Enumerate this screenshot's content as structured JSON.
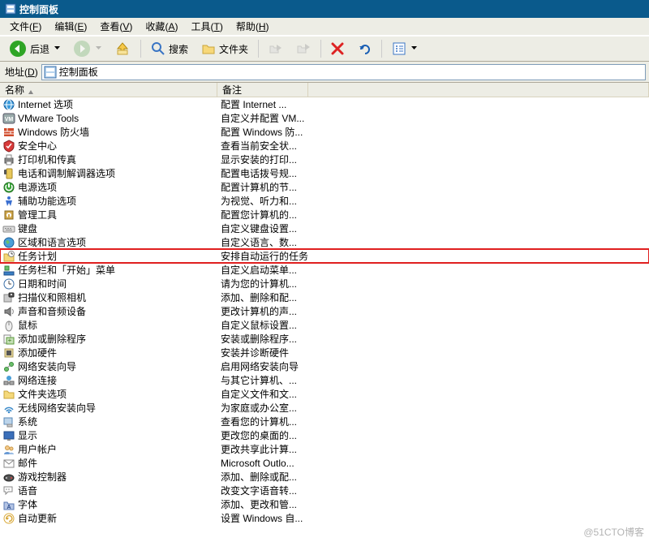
{
  "window": {
    "title": "控制面板"
  },
  "menu": {
    "items": [
      {
        "label": "文件",
        "ukey": "F"
      },
      {
        "label": "编辑",
        "ukey": "E"
      },
      {
        "label": "查看",
        "ukey": "V"
      },
      {
        "label": "收藏",
        "ukey": "A"
      },
      {
        "label": "工具",
        "ukey": "T"
      },
      {
        "label": "帮助",
        "ukey": "H"
      }
    ]
  },
  "toolbar": {
    "back_label": "后退",
    "search_label": "搜索",
    "folders_label": "文件夹"
  },
  "addressbar": {
    "label_text": "地址",
    "label_ukey": "D",
    "value": "控制面板"
  },
  "columns": {
    "name": "名称",
    "note": "备注"
  },
  "items": [
    {
      "icon": "internet",
      "name": "Internet 选项",
      "note": "配置 Internet ..."
    },
    {
      "icon": "vm",
      "name": "VMware Tools",
      "note": "自定义并配置 VM..."
    },
    {
      "icon": "firewall",
      "name": "Windows 防火墙",
      "note": "配置 Windows 防..."
    },
    {
      "icon": "security",
      "name": "安全中心",
      "note": "查看当前安全状..."
    },
    {
      "icon": "printer",
      "name": "打印机和传真",
      "note": "显示安装的打印..."
    },
    {
      "icon": "phone",
      "name": "电话和调制解调器选项",
      "note": "配置电话拨号规..."
    },
    {
      "icon": "power",
      "name": "电源选项",
      "note": "配置计算机的节..."
    },
    {
      "icon": "access",
      "name": "辅助功能选项",
      "note": "为视觉、听力和..."
    },
    {
      "icon": "admin",
      "name": "管理工具",
      "note": "配置您计算机的..."
    },
    {
      "icon": "keyboard",
      "name": "键盘",
      "note": "自定义键盘设置..."
    },
    {
      "icon": "region",
      "name": "区域和语言选项",
      "note": "自定义语言、数..."
    },
    {
      "icon": "schedule",
      "name": "任务计划",
      "note": "安排自动运行的任务",
      "highlight": true
    },
    {
      "icon": "taskbar",
      "name": "任务栏和「开始」菜单",
      "note": "自定义启动菜单..."
    },
    {
      "icon": "datetime",
      "name": "日期和时间",
      "note": "请为您的计算机..."
    },
    {
      "icon": "scanner",
      "name": "扫描仪和照相机",
      "note": "添加、删除和配..."
    },
    {
      "icon": "sound",
      "name": "声音和音频设备",
      "note": "更改计算机的声..."
    },
    {
      "icon": "mouse",
      "name": "鼠标",
      "note": "自定义鼠标设置..."
    },
    {
      "icon": "addremove",
      "name": "添加或删除程序",
      "note": "安装或删除程序..."
    },
    {
      "icon": "addhw",
      "name": "添加硬件",
      "note": "安装并诊断硬件"
    },
    {
      "icon": "network",
      "name": "网络安装向导",
      "note": "启用网络安装向导"
    },
    {
      "icon": "netconn",
      "name": "网络连接",
      "note": "与其它计算机、..."
    },
    {
      "icon": "folder",
      "name": "文件夹选项",
      "note": "自定义文件和文..."
    },
    {
      "icon": "wireless",
      "name": "无线网络安装向导",
      "note": "为家庭或办公室..."
    },
    {
      "icon": "system",
      "name": "系统",
      "note": "查看您的计算机..."
    },
    {
      "icon": "display",
      "name": "显示",
      "note": "更改您的桌面的..."
    },
    {
      "icon": "users",
      "name": "用户帐户",
      "note": "更改共享此计算..."
    },
    {
      "icon": "mail",
      "name": "邮件",
      "note": "Microsoft Outlo..."
    },
    {
      "icon": "gamectrl",
      "name": "游戏控制器",
      "note": "添加、删除或配..."
    },
    {
      "icon": "speech",
      "name": "语音",
      "note": "改变文字语音转..."
    },
    {
      "icon": "fonts",
      "name": "字体",
      "note": "添加、更改和管..."
    },
    {
      "icon": "update",
      "name": "自动更新",
      "note": "设置 Windows 自..."
    }
  ],
  "watermark": "@51CTO博客"
}
